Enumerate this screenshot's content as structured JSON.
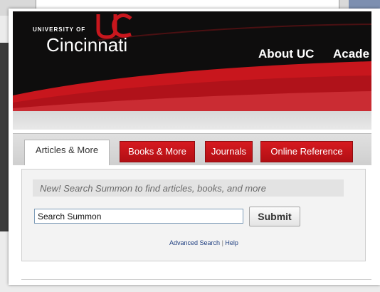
{
  "header": {
    "university_small": "UNIVERSITY OF",
    "university_name": "Cincinnati",
    "nav": [
      "About UC",
      "Acade"
    ]
  },
  "tabs": [
    {
      "label": "Articles & More",
      "active": true
    },
    {
      "label": "Books & More",
      "active": false
    },
    {
      "label": "Journals",
      "active": false
    },
    {
      "label": "Online Reference",
      "active": false
    }
  ],
  "search": {
    "hint": "New! Search Summon to find articles, books, and more",
    "value": "Search Summon",
    "submit_label": "Submit",
    "advanced_link": "Advanced Search",
    "separator": "|",
    "help_link": "Help"
  },
  "colors": {
    "brand_red": "#c8161d",
    "banner_black": "#0e0d0d"
  }
}
